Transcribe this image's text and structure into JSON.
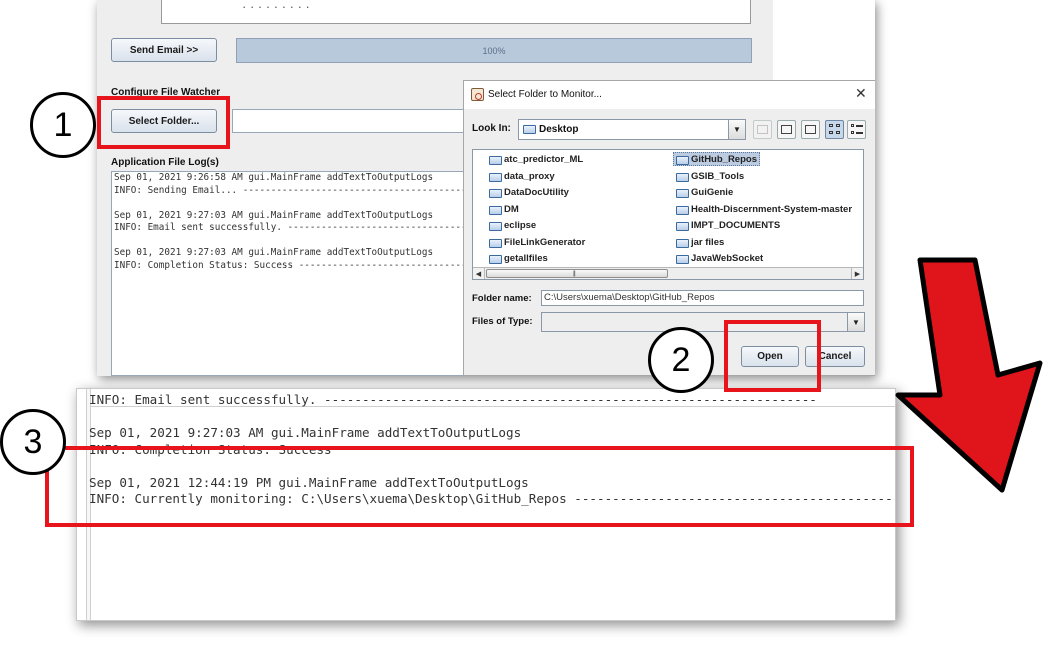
{
  "main_window": {
    "send_email_label": "Send Email >>",
    "progress_text": "100%",
    "progress_value": 100,
    "configure_label": "Configure File Watcher",
    "select_folder_label": "Select Folder...",
    "log_label": "Application File Log(s)",
    "log_lines": [
      "Sep 01, 2021 9:26:58 AM gui.MainFrame addTextToOutputLogs",
      "INFO: Sending Email... ------------------------------------------",
      "",
      "Sep 01, 2021 9:27:03 AM gui.MainFrame addTextToOutputLogs",
      "INFO: Email sent successfully. ----------------------------------",
      "",
      "Sep 01, 2021 9:27:03 AM gui.MainFrame addTextToOutputLogs",
      "INFO: Completion Status: Success --------------------------------"
    ]
  },
  "dialog": {
    "title": "Select Folder to Monitor...",
    "close_glyph": "✕",
    "look_in_label": "Look In:",
    "look_in_value": "Desktop",
    "files_left": [
      "atc_predictor_ML",
      "data_proxy",
      "DataDocUtility",
      "DM",
      "eclipse",
      "FileLinkGenerator",
      "getallfiles"
    ],
    "files_right": [
      "GitHub_Repos",
      "GSIB_Tools",
      "GuiGenie",
      "Health-Discernment-System-master",
      "IMPT_DOCUMENTS",
      "jar files",
      "JavaWebSocket"
    ],
    "selected_file": "GitHub_Repos",
    "folder_name_label": "Folder name:",
    "folder_name_value": "C:\\Users\\xuema\\Desktop\\GitHub_Repos",
    "files_of_type_label": "Files of Type:",
    "files_of_type_value": "",
    "open_label": "Open",
    "cancel_label": "Cancel"
  },
  "zoom_log": {
    "lines": [
      "INFO: Email sent successfully. -----------------------------------------------------------------",
      "",
      "Sep 01, 2021 9:27:03 AM gui.MainFrame addTextToOutputLogs",
      "INFO: Completion Status: Success",
      "",
      "Sep 01, 2021 12:44:19 PM gui.MainFrame addTextToOutputLogs",
      "INFO: Currently monitoring: C:\\Users\\xuema\\Desktop\\GitHub_Repos --------------------------------------------"
    ]
  },
  "annotations": {
    "step1": "1",
    "step2": "2",
    "step3": "3",
    "highlight_color": "#e8141b",
    "arrow_color": "#e0141b"
  }
}
